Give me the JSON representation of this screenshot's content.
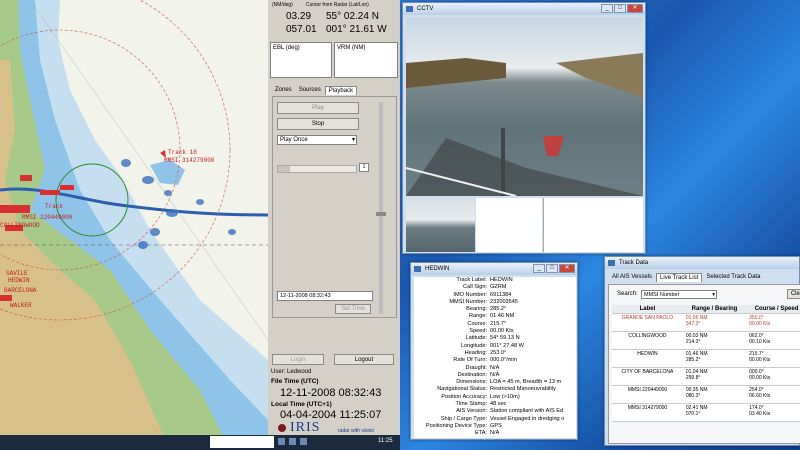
{
  "readout": {
    "hdr1": "(NM/deg)",
    "hdr2": "Cursor from Radar (Lat/Lon)",
    "range": "03.29",
    "bearing": "057.01",
    "lat": "55° 02.24 N",
    "lon": "001° 21.61 W"
  },
  "ebl": "EBL (deg)",
  "vrm": "VRM (NM)",
  "tabs": [
    "Zones",
    "Sources",
    "Playback"
  ],
  "playback": {
    "play": "Play",
    "stop": "Stop",
    "mode": "Play Once",
    "count": "1",
    "time": "12-11-2008 08:32:43",
    "set_time": "Set Time"
  },
  "login": "Login",
  "logout": "Logout",
  "user": "User: Ledwood",
  "file_time_label": "File Time (UTC)",
  "file_time": "12-11-2008 08:32:43",
  "local_time_label": "Local Time (UTC+1)",
  "local_time": "04-04-2004 11:25:07",
  "brand": "IRIS",
  "tagline": "radar with vision",
  "chart_labels": [
    "Track 18",
    "MMSI 314279000",
    "Track",
    "MMSI 220449000",
    "COLLINGWOOD",
    "HEDWIN",
    "BARCELONA",
    "WALKER",
    "SAVILE"
  ],
  "cctv": {
    "title": "CCTV"
  },
  "hedwin": {
    "title": "HEDWIN",
    "rows": [
      [
        "Track Label:",
        "HEDWIN"
      ],
      [
        "Call Sign:",
        "GZRM"
      ],
      [
        "IMO Number:",
        "6911384"
      ],
      [
        "MMSI Number:",
        "232003545"
      ],
      [
        "Bearing:",
        "285.2°"
      ],
      [
        "Range:",
        "01.46 NM"
      ],
      [
        "Course:",
        "215.7°"
      ],
      [
        "Speed:",
        "00.00 Kts"
      ],
      [
        "Latitude:",
        "54° 59.13 N"
      ],
      [
        "Longitude:",
        "001° 27.48 W"
      ],
      [
        "Heading:",
        "253.0°"
      ],
      [
        "Rate Of Turn:",
        "000.0°/min"
      ],
      [
        "Draught:",
        "N/A"
      ],
      [
        "Destination:",
        "N/A"
      ],
      [
        "Dimensions:",
        "LOA = 45 m, Breadth = 13 m"
      ],
      [
        "Navigational Status:",
        "Restricted Manoeuvrability"
      ],
      [
        "Position Accuracy:",
        "Low (>10m)"
      ],
      [
        "Time Stamp:",
        "48 sec"
      ],
      [
        "AIS Version:",
        "Station compliant with AIS Ed"
      ],
      [
        "Ship / Cargo Type:",
        "Vessel Engaged in dredging o"
      ],
      [
        "Positioning Device Type:",
        "GPS"
      ],
      [
        "ETA:",
        "N/A"
      ],
      [
        "RAIM In Use:",
        "No"
      ],
      [
        "Timeout:",
        "N/A"
      ]
    ]
  },
  "track": {
    "title": "Track Data",
    "tabs": [
      "All AIS Vessels",
      "Live Track List",
      "Selected Track Data"
    ],
    "search_label": "Search:",
    "search_value": "MMSI Number",
    "clear": "Clea",
    "cols": [
      "Label",
      "Range / Bearing",
      "Course / Speed"
    ],
    "rows": [
      [
        "GRANDE SAN PAOLO",
        "01.06 NM",
        "347.3°",
        "350.0°",
        "00.00 Kts"
      ],
      [
        "COLLINGWOOD",
        "00.03 NM",
        "214.3°",
        "062.0°",
        "00.10 Kts"
      ],
      [
        "HEDWIN",
        "01.46 NM",
        "285.2°",
        "215.7°",
        "00.00 Kts"
      ],
      [
        "CITY OF BARCELONA",
        "01.04 NM",
        "299.8°",
        "000.0°",
        "00.00 Kts"
      ],
      [
        "MMSI 220449000",
        "00.35 NM",
        "080.3°",
        "254.0°",
        "06.60 Kts"
      ],
      [
        "MMSI 314279000",
        "02.41 NM",
        "070.1°",
        "174.0°",
        "03.40 Kts"
      ]
    ]
  },
  "taskbar": {
    "clock": "11:25"
  }
}
